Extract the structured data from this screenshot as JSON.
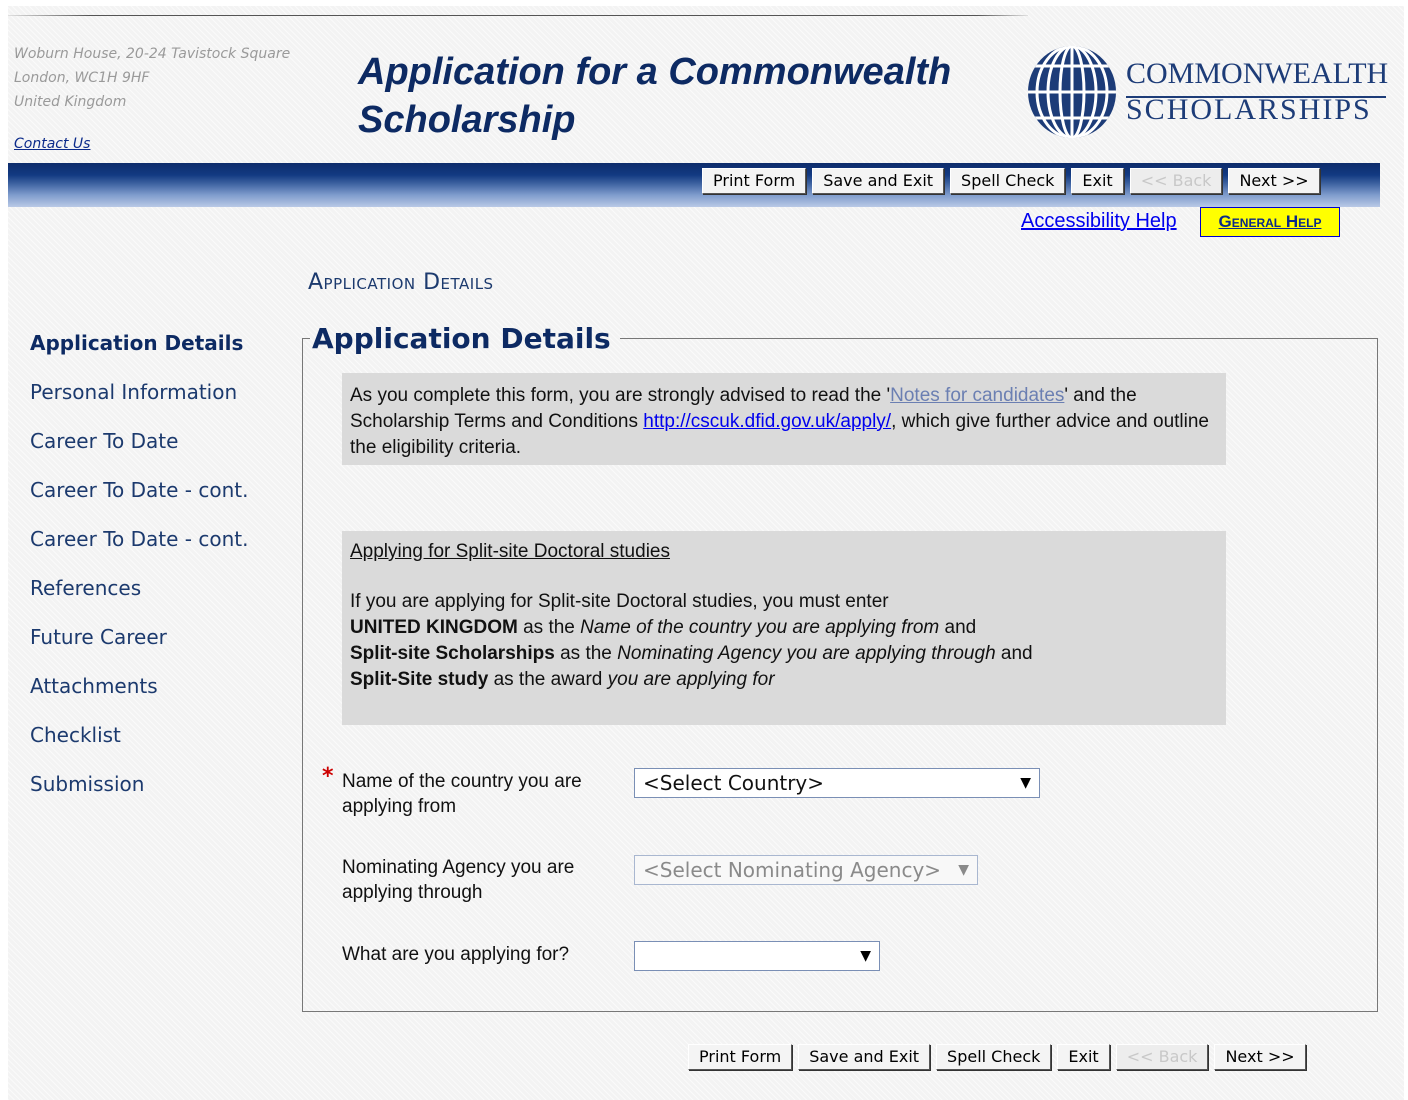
{
  "header": {
    "address": [
      "Woburn House, 20-24 Tavistock Square",
      "London, WC1H 9HF",
      "United Kingdom"
    ],
    "contact_link": "Contact Us",
    "title_line1": "Application for a Commonwealth",
    "title_line2": "Scholarship",
    "logo_line1": "COMMONWEALTH",
    "logo_line2": "SCHOLARSHIPS"
  },
  "toolbar": {
    "print": "Print Form",
    "save_exit": "Save and Exit",
    "spell": "Spell Check",
    "exit": "Exit",
    "back": "<< Back",
    "next": "Next >>"
  },
  "help": {
    "accessibility": "Accessibility Help",
    "general": "General Help"
  },
  "section_heading": "Application Details",
  "sidebar": {
    "items": [
      {
        "label": "Application Details"
      },
      {
        "label": "Personal Information"
      },
      {
        "label": "Career To Date"
      },
      {
        "label": "Career To Date - cont."
      },
      {
        "label": "Career To Date - cont."
      },
      {
        "label": "References"
      },
      {
        "label": "Future Career"
      },
      {
        "label": "Attachments"
      },
      {
        "label": "Checklist"
      },
      {
        "label": "Submission"
      }
    ]
  },
  "form": {
    "legend": "Application Details",
    "note1": {
      "p1": "As you complete this form, you are strongly advised to read the '",
      "link1": "Notes for candidates",
      "p2": "' and the Scholarship Terms and Conditions ",
      "link2": "http://cscuk.dfid.gov.uk/apply/",
      "p3": ", which give further advice and outline the eligibility criteria."
    },
    "note2": {
      "title": "Applying for Split-site Doctoral studies",
      "intro": "If you are applying for Split-site Doctoral studies, you must enter",
      "l1_b": "UNITED KINGDOM",
      "l1_t": " as the ",
      "l1_i": "Name of the country you are applying from",
      "l1_e": " and",
      "l2_b": "Split-site Scholarships",
      "l2_t": " as the ",
      "l2_i": "Nominating Agency you are applying through",
      "l2_e": " and",
      "l3_b": "Split-Site study",
      "l3_t": " as the award ",
      "l3_i": "you are applying for"
    },
    "country": {
      "label1": "Name of the country you are",
      "label2": "applying from",
      "value": "<Select Country>"
    },
    "agency": {
      "label1": "Nominating Agency you are",
      "label2": "applying through",
      "value": "<Select Nominating Agency>"
    },
    "award": {
      "label": "What are you applying for?",
      "value": ""
    },
    "required_mark": "*"
  },
  "icons": {
    "dropdown": "▼"
  },
  "colors": {
    "brand_navy": "#0d2a63",
    "help_yellow": "#ffff00",
    "required_red": "#cc0000"
  }
}
